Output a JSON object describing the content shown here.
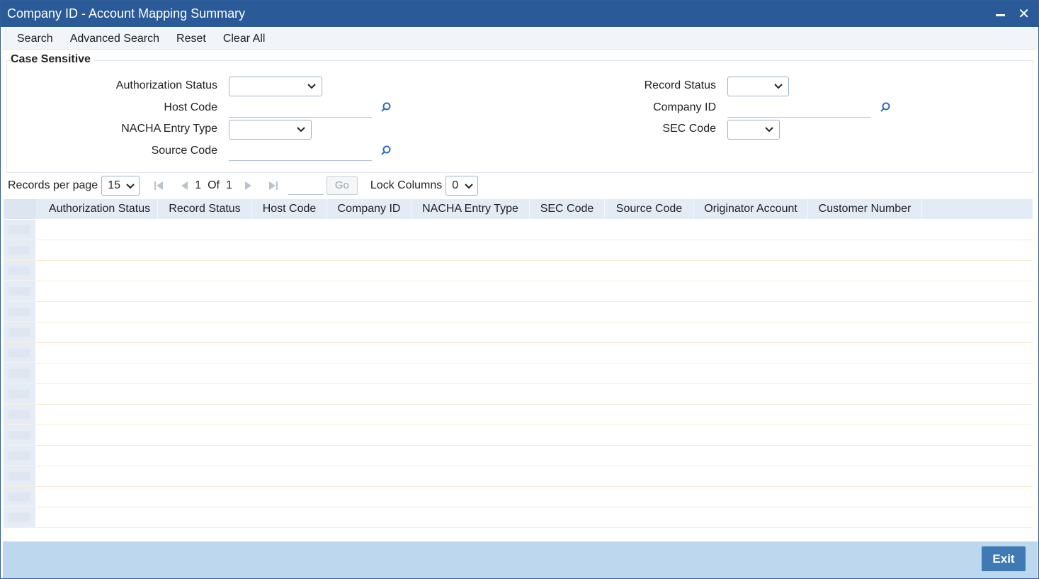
{
  "window": {
    "title": "Company ID - Account Mapping Summary"
  },
  "toolbar": {
    "search": "Search",
    "advanced_search": "Advanced Search",
    "reset": "Reset",
    "clear_all": "Clear All"
  },
  "criteria": {
    "title": "Case Sensitive",
    "authorization_status_label": "Authorization Status",
    "host_code_label": "Host Code",
    "nacha_entry_type_label": "NACHA Entry Type",
    "source_code_label": "Source Code",
    "record_status_label": "Record Status",
    "company_id_label": "Company ID",
    "sec_code_label": "SEC Code",
    "authorization_status_value": "",
    "nacha_entry_type_value": "",
    "record_status_value": "",
    "sec_code_value": "",
    "host_code_value": "",
    "source_code_value": "",
    "company_id_value": ""
  },
  "pager": {
    "records_per_page_label": "Records per page",
    "records_per_page_value": "15",
    "current_page": "1",
    "of_label": "Of",
    "total_pages": "1",
    "go_label": "Go",
    "lock_columns_label": "Lock Columns",
    "lock_columns_value": "0"
  },
  "grid": {
    "columns": [
      "Authorization Status",
      "Record Status",
      "Host Code",
      "Company ID",
      "NACHA Entry Type",
      "SEC Code",
      "Source Code",
      "Originator Account",
      "Customer Number"
    ],
    "row_count": 15
  },
  "footer": {
    "exit_label": "Exit"
  },
  "colors": {
    "titlebar": "#2a5a97",
    "footer": "#bdd7ee",
    "exit_button": "#3f7ab5",
    "grid_header": "#e3ebf5"
  },
  "icons": {
    "minimize": "minimize-icon",
    "close": "close-icon",
    "lov": "search-icon",
    "dropdown": "chevron-down-icon"
  }
}
